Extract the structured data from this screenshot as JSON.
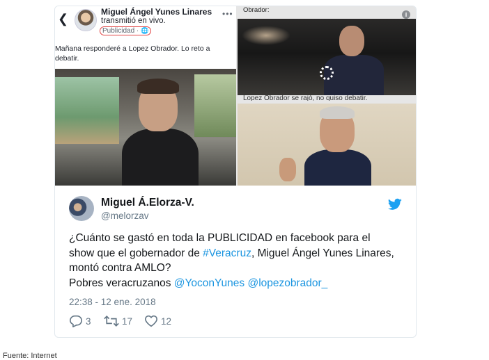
{
  "facebook_post": {
    "author": "Miguel Ángel Yunes Linares",
    "subtitle": "transmitió en vivo.",
    "sponsored": "Publicidad ·",
    "text": "Mañana responderé a Lopez Obrador. Lo reto a debatir."
  },
  "right_panel": {
    "label": "Obrador:",
    "cutoff_caption": "Lopez Obrador se rajó, no quiso debatir."
  },
  "tweet": {
    "display_name": "Miguel Á.Elorza-V.",
    "handle": "@melorzav",
    "text_1": "¿Cuánto se gastó en toda la PUBLICIDAD en facebook para el show que el gobernador de ",
    "hashtag": "#Veracruz",
    "text_2": ", Miguel Ángel Yunes Linares,  montó contra AMLO?",
    "text_3": "Pobres veracruzanos ",
    "mention_1": "@YoconYunes",
    "mention_2": "@lopezobrador_",
    "timestamp": "22:38 - 12 ene. 2018",
    "reply_count": "3",
    "retweet_count": "17",
    "like_count": "12"
  },
  "footer": {
    "text": "Fuente: Internet"
  },
  "colors": {
    "link": "#1b95e0",
    "twitter_blue": "#1da1f2",
    "muted": "#657786"
  }
}
